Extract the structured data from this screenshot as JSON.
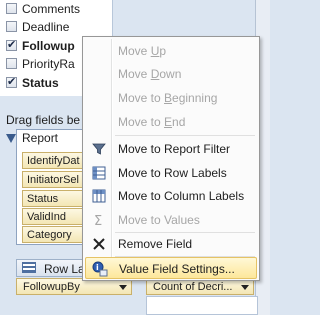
{
  "field_list": {
    "fields": [
      {
        "label": "Comments",
        "checked": false,
        "bold": false
      },
      {
        "label": "Deadline",
        "checked": false,
        "bold": false
      },
      {
        "label": "Followup",
        "checked": true,
        "bold": true
      },
      {
        "label": "PriorityRa",
        "checked": false,
        "bold": false
      },
      {
        "label": "Status",
        "checked": true,
        "bold": true
      }
    ]
  },
  "areas": {
    "drag_label": "Drag fields be",
    "report_filter_label": "Report",
    "report_filter_chips": [
      "IdentifyDat",
      "InitiatorSel",
      "Status",
      "ValidInd",
      "Category"
    ],
    "row_labels_label": "Row Lal",
    "row_chip": "FollowupBy",
    "values_chip": "Count of Decri..."
  },
  "context_menu": {
    "items": [
      {
        "label": "Move Up",
        "accel_prefix": "Move ",
        "accel": "U",
        "accel_suffix": "p",
        "enabled": false,
        "icon": ""
      },
      {
        "label": "Move Down",
        "accel_prefix": "Move ",
        "accel": "D",
        "accel_suffix": "own",
        "enabled": false,
        "icon": ""
      },
      {
        "label": "Move to Beginning",
        "accel_prefix": "Move to ",
        "accel": "B",
        "accel_suffix": "eginning",
        "enabled": false,
        "icon": ""
      },
      {
        "label": "Move to End",
        "accel_prefix": "Move to ",
        "accel": "E",
        "accel_suffix": "nd",
        "enabled": false,
        "icon": ""
      },
      {
        "label": "Move to Report Filter",
        "enabled": true,
        "icon": "filter-icon"
      },
      {
        "label": "Move to Row Labels",
        "enabled": true,
        "icon": "row-labels-icon"
      },
      {
        "label": "Move to Column Labels",
        "enabled": true,
        "icon": "column-labels-icon"
      },
      {
        "label": "Move to Values",
        "enabled": false,
        "icon": "sigma-icon"
      },
      {
        "label": "Remove Field",
        "enabled": true,
        "icon": "remove-x-icon"
      },
      {
        "label": "Value Field Settings...",
        "enabled": true,
        "icon": "field-settings-icon",
        "highlighted": true
      }
    ],
    "highlight_color": "#fde79a"
  }
}
